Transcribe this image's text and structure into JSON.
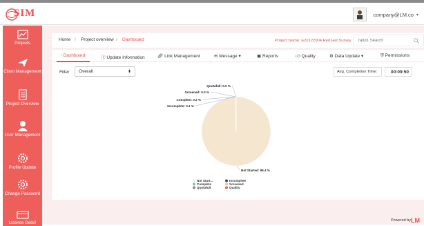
{
  "app": {
    "logo_text": "SIM",
    "user_name": "company@LM.co"
  },
  "sidebar": {
    "items": [
      {
        "label": "Projects",
        "icon": "chart-icon"
      },
      {
        "label": "Client Management",
        "icon": "paper-plane-icon"
      },
      {
        "label": "Project Overview",
        "icon": "document-icon"
      },
      {
        "label": "User Management",
        "icon": "user-icon"
      },
      {
        "label": "Profile Update",
        "icon": "gear-icon"
      },
      {
        "label": "Change Password",
        "icon": "gear-icon"
      },
      {
        "label": "License Detail",
        "icon": "card-icon"
      }
    ],
    "toggle": "›"
  },
  "breadcrumb": {
    "home": "Home",
    "sep1": "/",
    "overview": "Project overview",
    "sep2": "/",
    "current": "Dashboard"
  },
  "project_name": "Project Name: E20122004 Red Hat Survey",
  "search": {
    "placeholder": "rafid1 Search"
  },
  "tabs": [
    {
      "label": "Dashboard"
    },
    {
      "label": "Update Information"
    },
    {
      "label": "Link Management"
    },
    {
      "label": "Message ▾"
    },
    {
      "label": "Reports"
    },
    {
      "label": "Quality"
    },
    {
      "label": "Data Update ▾"
    },
    {
      "label": "Permissions"
    }
  ],
  "filter": {
    "label": "Filter",
    "selected": "Overall"
  },
  "completion": {
    "label": "Avg. Completion Time:",
    "value": "00:09:50"
  },
  "chart_data": {
    "type": "pie",
    "categories": [
      "Not Started",
      "Incomplete",
      "Complete",
      "Screened",
      "Quotafull",
      "Quality"
    ],
    "values": [
      99.4,
      0.1,
      0.2,
      0.3,
      0.0,
      0.0
    ],
    "slice_labels": [
      "Not Started: 99.4 %",
      "Incomplete: 0.1 %",
      "Complete: 0.2 %",
      "Screened: 0.3 %",
      "Quotafull: 0.0 %"
    ],
    "legend_labels": [
      "Not Start...",
      "Incomplete",
      "Complete",
      "Screened",
      "Quotafull",
      "Quality"
    ],
    "colors": [
      "#f5e6cf",
      "#3f4a5a",
      "#7ec8a0",
      "#e8d46b",
      "#8c7bb8",
      "#e86464"
    ],
    "legend_position": "bottom"
  },
  "footer": {
    "powered_by": "Powered by",
    "powered_logo": "LM"
  }
}
